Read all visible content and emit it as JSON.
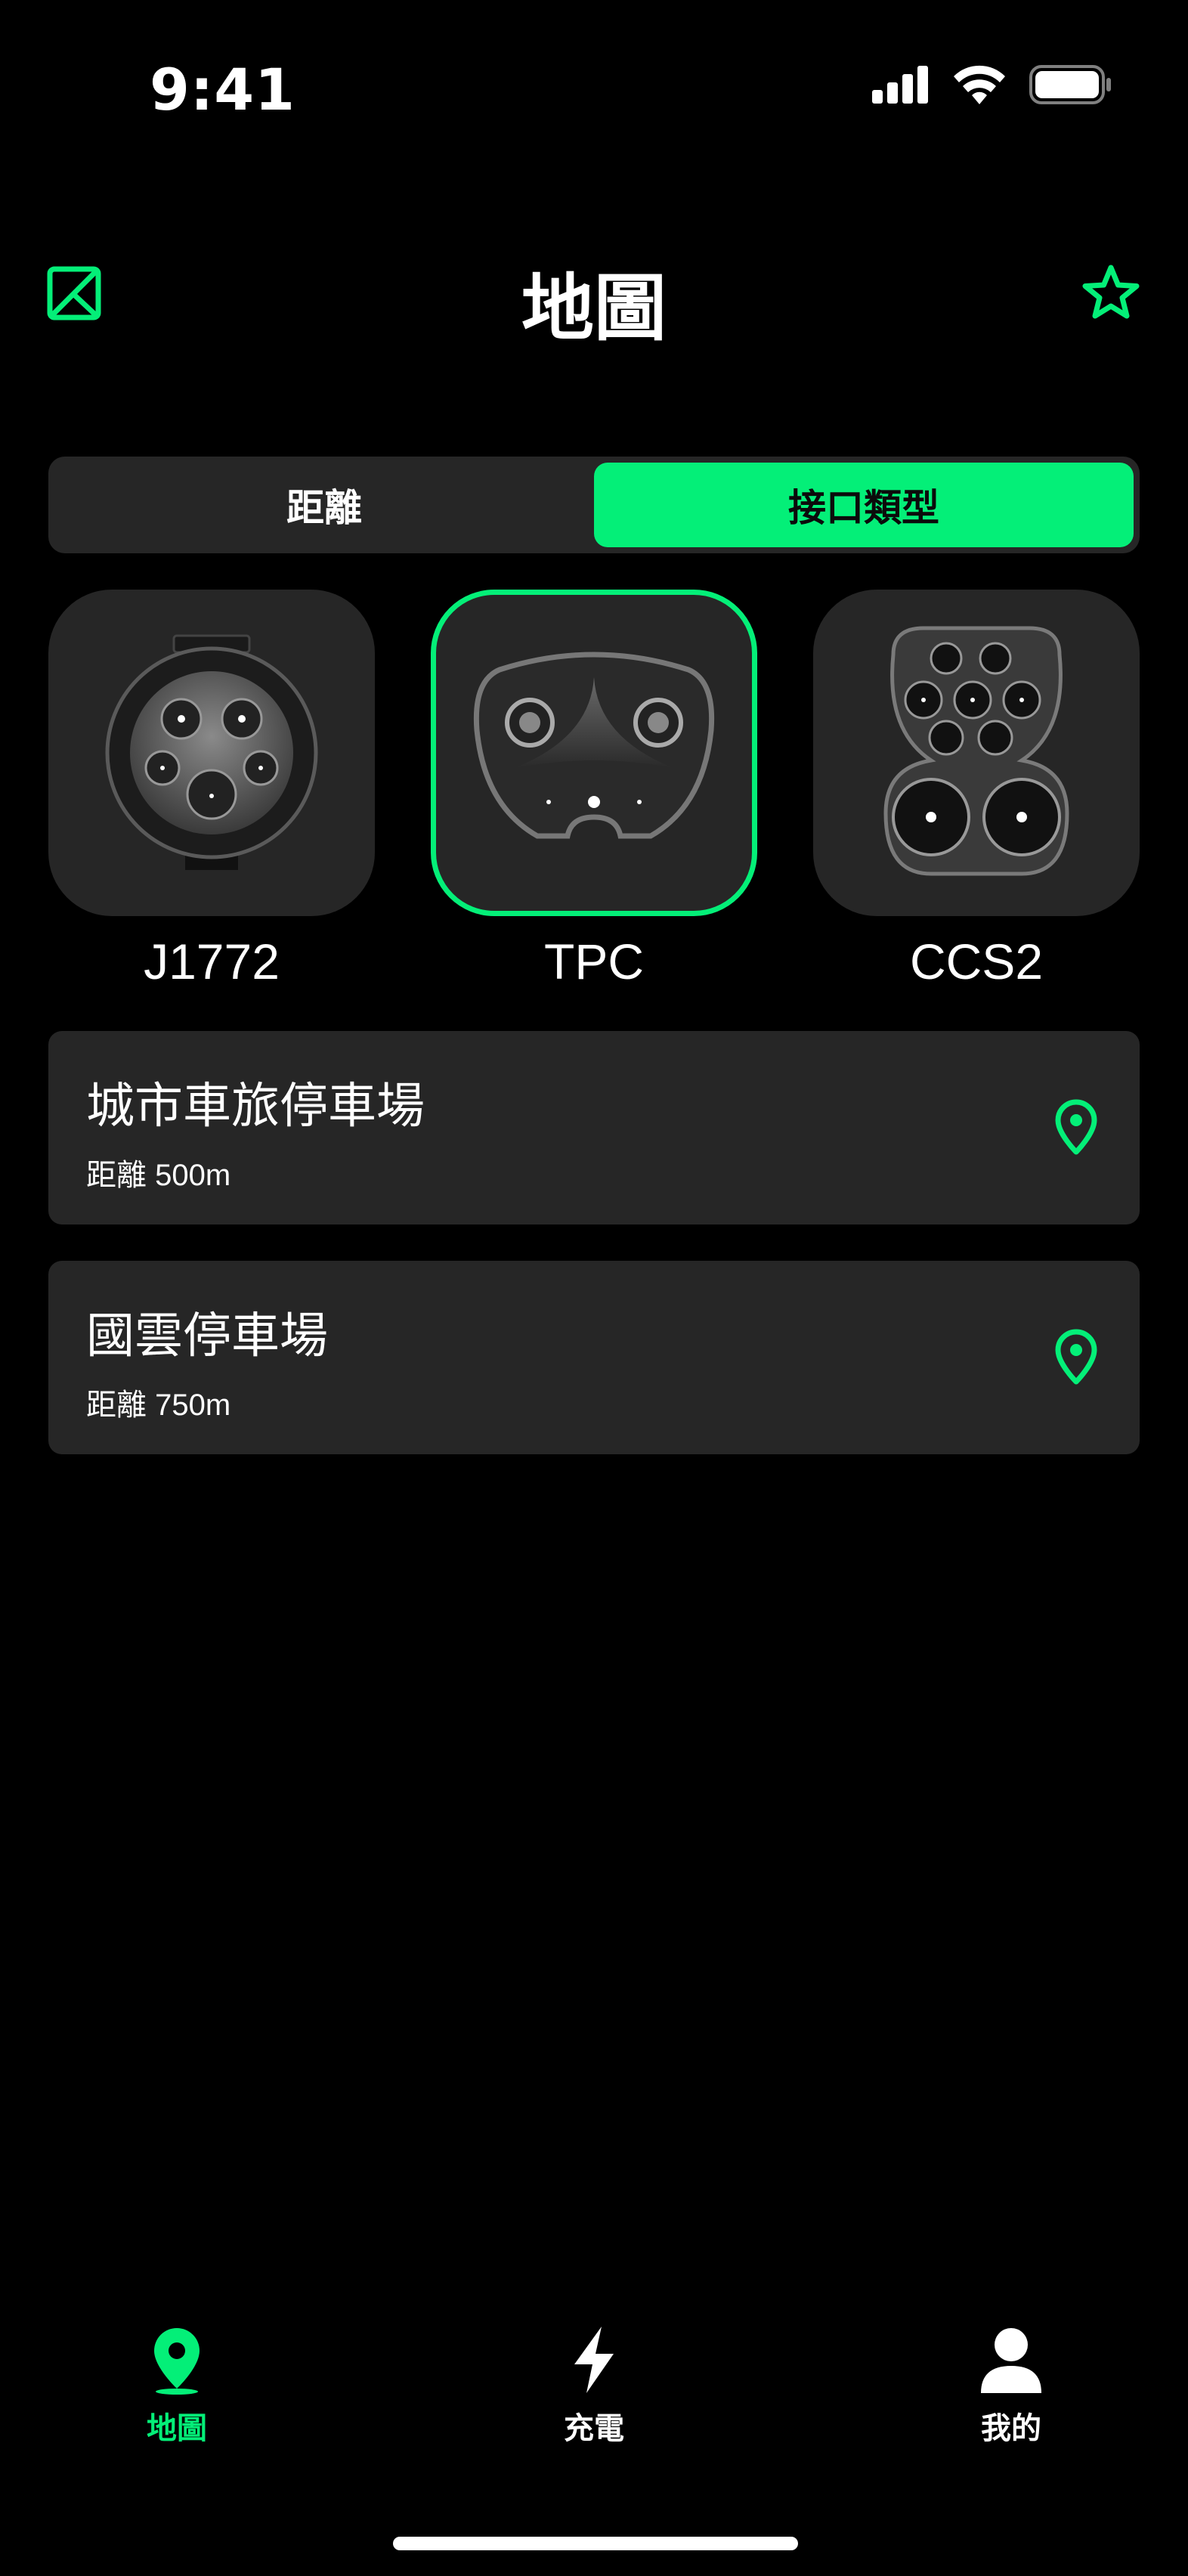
{
  "status": {
    "time": "9:41"
  },
  "header": {
    "title": "地圖",
    "left_icon": "image-icon",
    "right_icon": "star-icon"
  },
  "segments": [
    {
      "label": "距離",
      "active": false
    },
    {
      "label": "接口類型",
      "active": true
    }
  ],
  "connectors": [
    {
      "label": "J1772",
      "selected": false
    },
    {
      "label": "TPC",
      "selected": true
    },
    {
      "label": "CCS2",
      "selected": false
    }
  ],
  "stations": [
    {
      "name": "城市車旅停車場",
      "distance": "距離 500m"
    },
    {
      "name": "國雲停車場",
      "distance": "距離 750m"
    }
  ],
  "tabs": [
    {
      "label": "地圖",
      "icon": "map-pin-icon",
      "active": true
    },
    {
      "label": "充電",
      "icon": "bolt-icon",
      "active": false
    },
    {
      "label": "我的",
      "icon": "person-icon",
      "active": false
    }
  ],
  "colors": {
    "accent": "#04ef78",
    "background": "#000000",
    "card": "#262626"
  }
}
